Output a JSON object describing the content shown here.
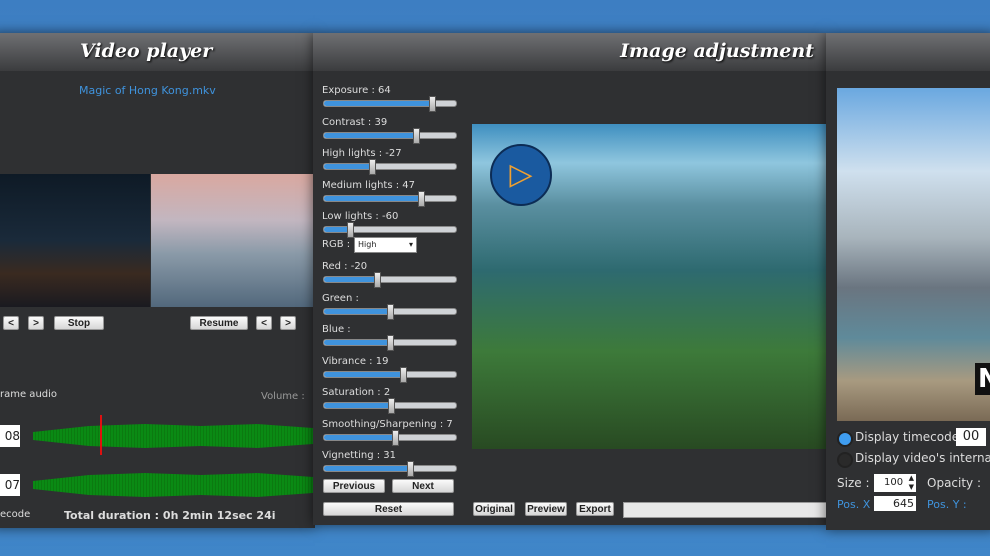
{
  "video_player": {
    "title": "Video player",
    "filename": "Magic of Hong Kong.mkv",
    "prev": "<",
    "next": ">",
    "stop": "Stop",
    "resume": "Resume",
    "frame_audio": "rame audio",
    "volume": "Volume :",
    "tc1": "08",
    "tc2": "07",
    "timecode": "ecode",
    "duration": "Total duration : 0h 2min 12sec 24i"
  },
  "image_adjustment": {
    "title": "Image adjustment",
    "sliders": [
      {
        "label": "Exposure : 64",
        "value": 64
      },
      {
        "label": "Contrast : 39",
        "value": 39
      },
      {
        "label": "High lights : -27",
        "value": -27
      },
      {
        "label": "Medium lights : 47",
        "value": 47
      },
      {
        "label": "Low lights : -60",
        "value": -60
      },
      {
        "label": "Red : -20",
        "value": -20
      },
      {
        "label": "Green :",
        "value": 0
      },
      {
        "label": "Blue :",
        "value": 0
      },
      {
        "label": "Vibrance : 19",
        "value": 19
      },
      {
        "label": "Saturation : 2",
        "value": 2
      },
      {
        "label": "Smoothing/Sharpening : 7",
        "value": 7
      },
      {
        "label": "Vignetting : 31",
        "value": 31
      }
    ],
    "rgb_label": "RGB :",
    "rgb_value": "High",
    "previous": "Previous",
    "next": "Next",
    "reset": "Reset",
    "original": "Original",
    "preview": "Preview",
    "export": "Export"
  },
  "overlay": {
    "display_timecode": "Display timecode :",
    "timecode_value": "00",
    "display_internal": "Display video's internal tim",
    "size_label": "Size :",
    "size_value": "100",
    "opacity_label": "Opacity :",
    "posx_label": "Pos. X",
    "posx_value": "645",
    "posy_label": "Pos. Y :"
  },
  "colors": {
    "accent": "#3f93dd",
    "wave": "#0a8a14",
    "playhead": "#e01010"
  }
}
